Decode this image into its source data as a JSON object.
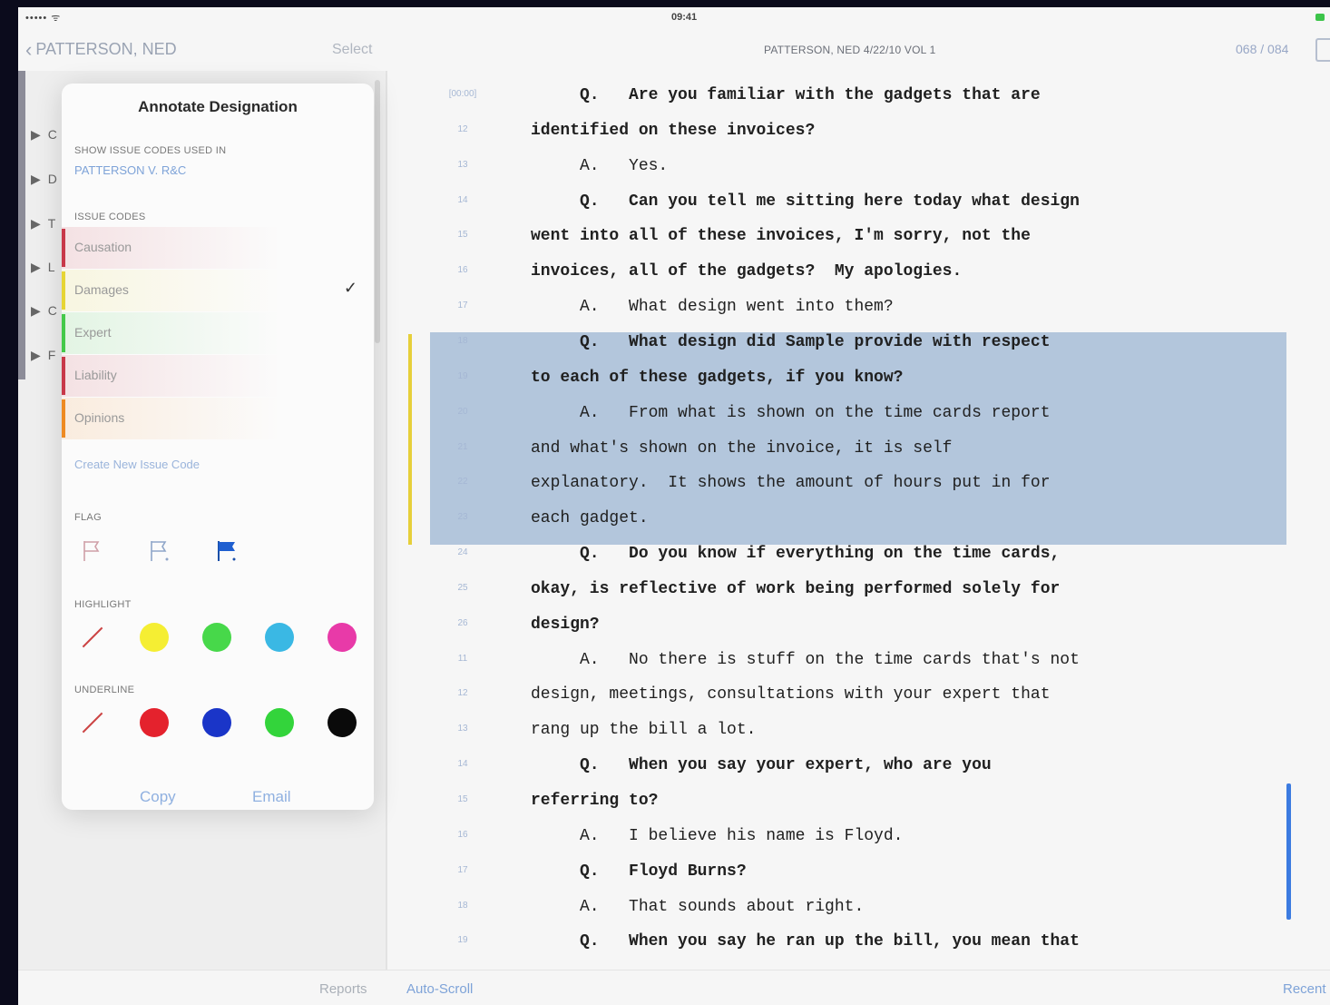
{
  "status": {
    "signal": "••••• ᯤ",
    "time": "09:41"
  },
  "nav": {
    "back_label": "PATTERSON, NED",
    "select_label": "Select",
    "doc_title": "PATTERSON, NED 4/22/10 VOL 1",
    "page_count": "068 / 084"
  },
  "tree": [
    "C",
    "D",
    "T",
    "L",
    "C",
    "F"
  ],
  "popover": {
    "title": "Annotate Designation",
    "show_label": "SHOW ISSUE CODES USED IN",
    "case_link": "PATTERSON V. R&C",
    "issue_codes_label": "ISSUE CODES",
    "issues": [
      {
        "name": "Causation",
        "color": "#c8394a",
        "checked": false
      },
      {
        "name": "Damages",
        "color": "#e6d534",
        "checked": true
      },
      {
        "name": "Expert",
        "color": "#44c94a",
        "checked": false
      },
      {
        "name": "Liability",
        "color": "#c8394a",
        "checked": false
      },
      {
        "name": "Opinions",
        "color": "#ee8a22",
        "checked": false
      }
    ],
    "check_glyph": "✓",
    "create_link": "Create New Issue Code",
    "flag_label": "FLAG",
    "highlight_label": "HIGHLIGHT",
    "highlight_colors": [
      "#f5ee33",
      "#47d84a",
      "#3ab8e4",
      "#e83aa8"
    ],
    "underline_label": "UNDERLINE",
    "underline_colors": [
      "#e4222d",
      "#1a35c8",
      "#33d43b",
      "#0a0a0a"
    ],
    "copy_label": "Copy",
    "email_label": "Email"
  },
  "transcript": [
    {
      "ln": "[00:00]",
      "text": "     Q.   Are you familiar with the gadgets that are",
      "bold": true
    },
    {
      "ln": "12",
      "text": "identified on these invoices?",
      "bold": true
    },
    {
      "ln": "13",
      "text": "     A.   Yes.",
      "bold": false
    },
    {
      "ln": "14",
      "text": "     Q.   Can you tell me sitting here today what design",
      "bold": true
    },
    {
      "ln": "15",
      "text": "went into all of these invoices, I'm sorry, not the",
      "bold": true
    },
    {
      "ln": "16",
      "text": "invoices, all of the gadgets?  My apologies.",
      "bold": true
    },
    {
      "ln": "17",
      "text": "     A.   What design went into them?",
      "bold": false
    },
    {
      "ln": "18",
      "text": "     Q.   What design did Sample provide with respect",
      "bold": true
    },
    {
      "ln": "19",
      "text": "to each of these gadgets, if you know?",
      "bold": true
    },
    {
      "ln": "20",
      "text": "     A.   From what is shown on the time cards report",
      "bold": false
    },
    {
      "ln": "21",
      "text": "and what's shown on the invoice, it is self",
      "bold": false
    },
    {
      "ln": "22",
      "text": "explanatory.  It shows the amount of hours put in for",
      "bold": false
    },
    {
      "ln": "23",
      "text": "each gadget.",
      "bold": false
    },
    {
      "ln": "24",
      "text": "     Q.   Do you know if everything on the time cards,",
      "bold": true
    },
    {
      "ln": "25",
      "text": "okay, is reflective of work being performed solely for",
      "bold": true
    },
    {
      "ln": "26",
      "text": "design?",
      "bold": true
    },
    {
      "ln": "11",
      "text": "     A.   No there is stuff on the time cards that's not",
      "bold": false
    },
    {
      "ln": "12",
      "text": "design, meetings, consultations with your expert that",
      "bold": false
    },
    {
      "ln": "13",
      "text": "rang up the bill a lot.",
      "bold": false
    },
    {
      "ln": "14",
      "text": "     Q.   When you say your expert, who are you",
      "bold": true
    },
    {
      "ln": "15",
      "text": "referring to?",
      "bold": true
    },
    {
      "ln": "16",
      "text": "     A.   I believe his name is Floyd.",
      "bold": false
    },
    {
      "ln": "17",
      "text": "     Q.   Floyd Burns?",
      "bold": true
    },
    {
      "ln": "18",
      "text": "     A.   That sounds about right.",
      "bold": false
    },
    {
      "ln": "19",
      "text": "     Q.   When you say he ran up the bill, you mean that",
      "bold": true
    }
  ],
  "bottom": {
    "reports_label": "Reports",
    "autoscroll_label": "Auto-Scroll",
    "recent_label": "Recent"
  }
}
